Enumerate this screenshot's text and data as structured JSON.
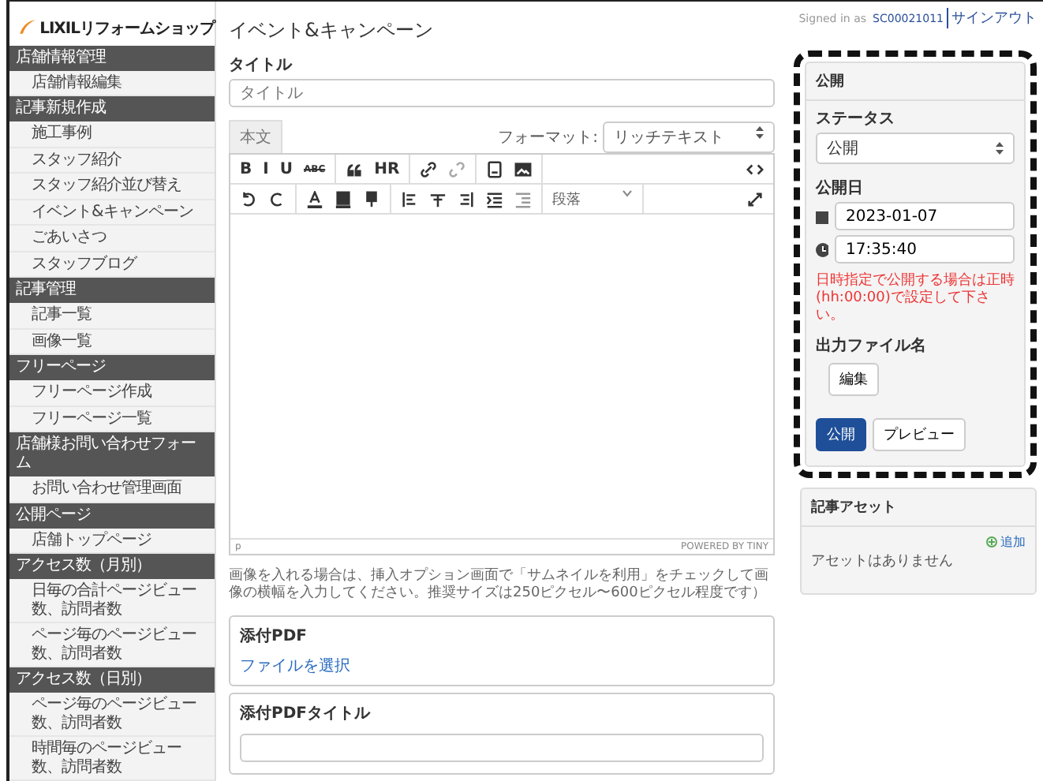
{
  "header": {
    "logo": "LIXILリフォームショップ",
    "signed_in_label": "Signed in as",
    "user_id": "SC00021011",
    "sign_out": "サインアウト"
  },
  "sidebar": {
    "sections": [
      {
        "title": "店舗情報管理",
        "items": [
          {
            "label": "店舗情報編集"
          }
        ]
      },
      {
        "title": "記事新規作成",
        "items": [
          {
            "label": "施工事例"
          },
          {
            "label": "スタッフ紹介"
          },
          {
            "label": "スタッフ紹介並び替え"
          },
          {
            "label": "イベント&キャンペーン"
          },
          {
            "label": "ごあいさつ"
          },
          {
            "label": "スタッフブログ"
          }
        ]
      },
      {
        "title": "記事管理",
        "items": [
          {
            "label": "記事一覧"
          },
          {
            "label": "画像一覧"
          }
        ]
      },
      {
        "title": "フリーページ",
        "items": [
          {
            "label": "フリーページ作成"
          },
          {
            "label": "フリーページ一覧"
          }
        ]
      },
      {
        "title": "店舗様お問い合わせフォーム",
        "items": [
          {
            "label": "お問い合わせ管理画面"
          }
        ]
      },
      {
        "title": "公開ページ",
        "items": [
          {
            "label": "店舗トップページ"
          }
        ]
      },
      {
        "title": "アクセス数（月別）",
        "items": [
          {
            "label": "日毎の合計ページビュー数、訪問者数"
          },
          {
            "label": "ページ毎のページビュー数、訪問者数"
          }
        ]
      },
      {
        "title": "アクセス数（日別）",
        "items": [
          {
            "label": "ページ毎のページビュー数、訪問者数"
          },
          {
            "label": "時間毎のページビュー数、訪問者数"
          }
        ]
      }
    ]
  },
  "page_title": "イベント&キャンペーン",
  "title_field": {
    "label": "タイトル",
    "placeholder": "タイトル"
  },
  "editor": {
    "tab": "本文",
    "format_label": "フォーマット:",
    "format_value": "リッチテキスト",
    "toolbar_rows": [
      [
        [
          {
            "kind": "text",
            "label": "B"
          },
          {
            "kind": "text",
            "label": "I"
          },
          {
            "kind": "text",
            "label": "U"
          },
          {
            "kind": "text",
            "label": "ABC"
          }
        ],
        [
          {
            "kind": "icon"
          },
          {
            "kind": "text",
            "label": "HR"
          }
        ],
        [
          {
            "kind": "icon"
          },
          {
            "kind": "icon"
          }
        ],
        [
          {
            "kind": "icon"
          },
          {
            "kind": "icon"
          }
        ],
        [
          {
            "kind": "icon"
          }
        ]
      ],
      [
        [
          {
            "kind": "icon"
          },
          {
            "kind": "icon"
          }
        ],
        [
          {
            "kind": "icon"
          },
          {
            "kind": "icon"
          },
          {
            "kind": "icon"
          }
        ],
        [
          {
            "kind": "icon"
          },
          {
            "kind": "icon"
          },
          {
            "kind": "icon"
          },
          {
            "kind": "icon"
          },
          {
            "kind": "icon"
          }
        ],
        [
          {
            "kind": "select",
            "label": "段落"
          }
        ],
        [
          {
            "kind": "icon"
          }
        ]
      ]
    ],
    "path": "p",
    "powered_by": "POWERED BY TINY"
  },
  "image_note": "画像を入れる場合は、挿入オプション画面で「サムネイルを利用」をチェックして画像の横幅を入力してください。推奨サイズは250ピクセル〜600ピクセル程度です）",
  "attachment_pdf": {
    "label": "添付PDF",
    "link": "ファイルを選択"
  },
  "attachment_pdf_title": {
    "label": "添付PDFタイトル"
  },
  "publish_panel": {
    "title": "公開",
    "status_label": "ステータス",
    "status_value": "公開",
    "date_label": "公開日",
    "date": "2023-01-07",
    "time": "17:35:40",
    "warning": "日時指定で公開する場合は正時(hh:00:00)で設定して下さい。",
    "output_file_label": "出力ファイル名",
    "edit_button": "編集",
    "publish_button": "公開",
    "preview_button": "プレビュー"
  },
  "asset_panel": {
    "title": "記事アセット",
    "add_link": "追加",
    "empty": "アセットはありません"
  }
}
